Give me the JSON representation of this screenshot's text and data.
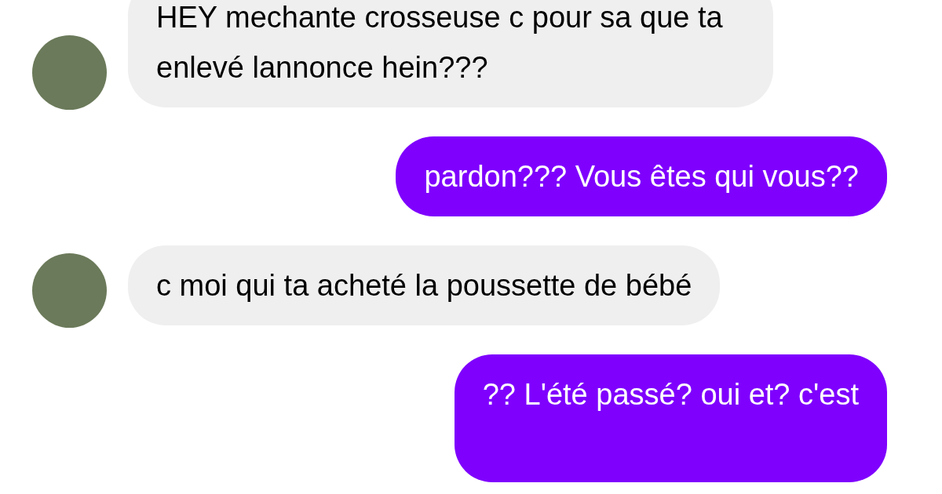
{
  "messages": [
    {
      "kind": "received",
      "text": "HEY mechante crosseuse c pour sa que ta enlevé lannonce hein???"
    },
    {
      "kind": "sent",
      "text": "pardon??? Vous êtes qui vous??"
    },
    {
      "kind": "received",
      "text": "c moi qui ta acheté la poussette de bébé"
    },
    {
      "kind": "sent",
      "text": "?? L'été passé? oui et? c'est"
    }
  ]
}
